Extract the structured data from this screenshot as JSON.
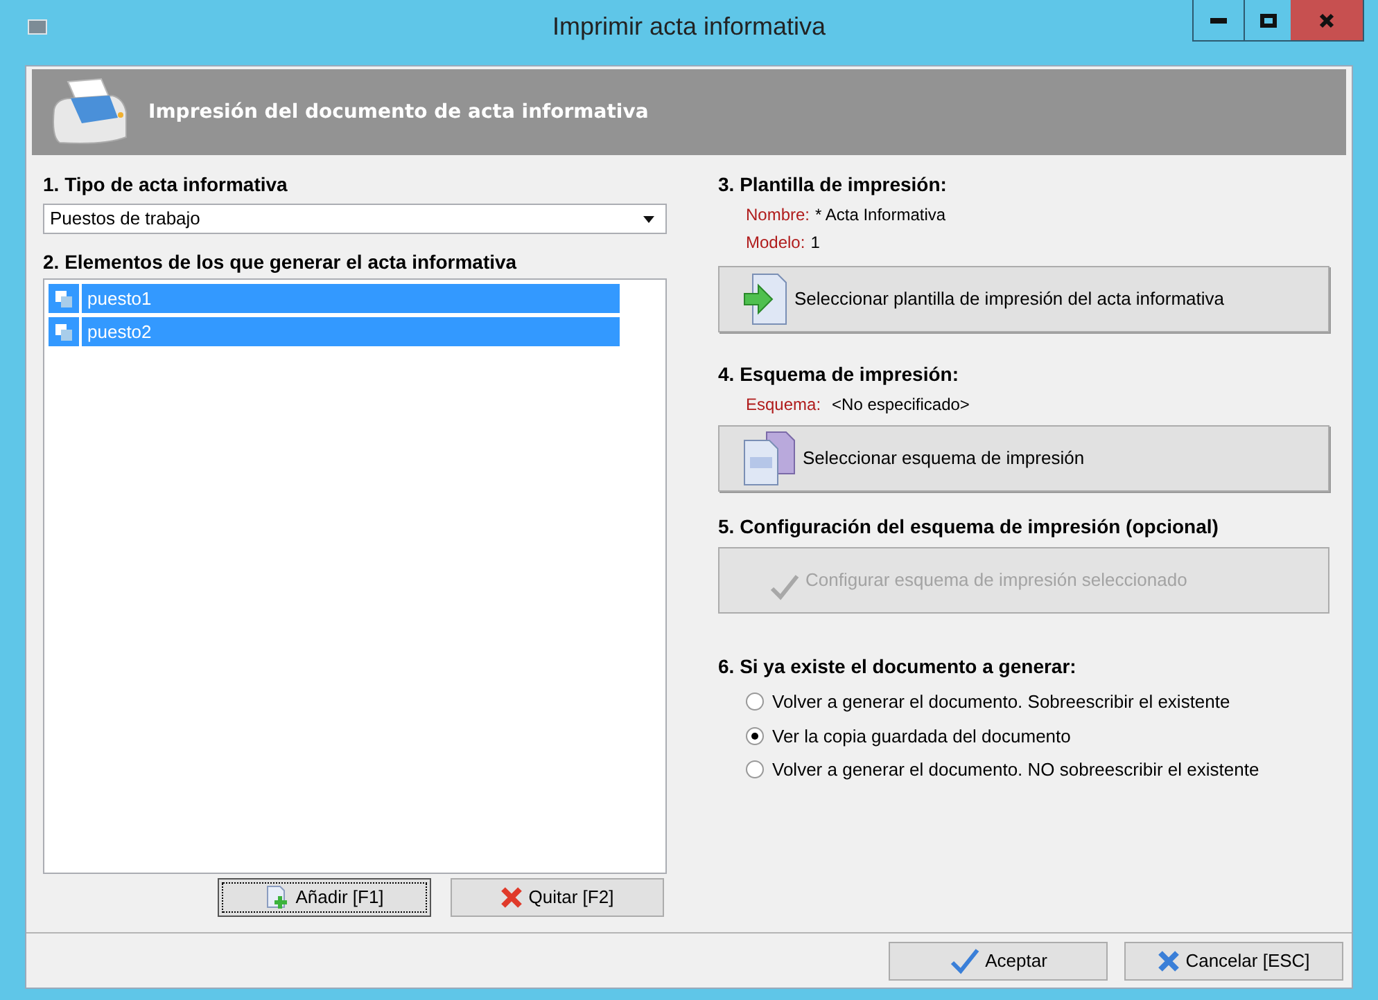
{
  "window": {
    "title": "Imprimir acta informativa"
  },
  "header": {
    "title": "Impresión del documento de acta informativa"
  },
  "tipo": {
    "label": "1. Tipo de acta informativa",
    "value": "Puestos de trabajo"
  },
  "elementos": {
    "label": "2. Elementos de los que generar el acta informativa",
    "items": [
      {
        "label": "puesto1",
        "selected": true
      },
      {
        "label": "puesto2",
        "selected": true
      }
    ],
    "buttons": [
      {
        "kind": "add",
        "label": "Añadir [F1]",
        "focused": true
      },
      {
        "kind": "remove",
        "label": "Quitar [F2]",
        "focused": false
      }
    ]
  },
  "plantilla": {
    "label": "3. Plantilla de impresión:",
    "fields": [
      {
        "label": "Nombre:",
        "value": "* Acta Informativa"
      },
      {
        "label": "Modelo:",
        "value": "1"
      }
    ],
    "button": {
      "label": "Seleccionar plantilla de impresión del acta informativa",
      "disabled": false
    }
  },
  "esquema": {
    "label": "4. Esquema de impresión:",
    "fields": [
      {
        "label": "Esquema:",
        "value": "<No especificado>"
      }
    ],
    "button": {
      "label": "Seleccionar esquema de impresión",
      "disabled": false
    }
  },
  "configuracion": {
    "label": "5. Configuración del esquema de impresión (opcional)",
    "button": {
      "label": "Configurar esquema de impresión seleccionado",
      "disabled": true
    }
  },
  "existente": {
    "label": "6. Si ya existe el documento a generar:",
    "options": [
      {
        "label": "Volver a generar el documento. Sobreescribir el existente",
        "selected": false
      },
      {
        "label": "Ver la copia guardada del documento",
        "selected": true
      },
      {
        "label": "Volver a generar el documento. NO sobreescribir el existente",
        "selected": false
      }
    ]
  },
  "footer": {
    "buttons": [
      {
        "kind": "ok",
        "label": "Aceptar"
      },
      {
        "kind": "cancel",
        "label": "Cancelar [ESC]"
      }
    ]
  }
}
